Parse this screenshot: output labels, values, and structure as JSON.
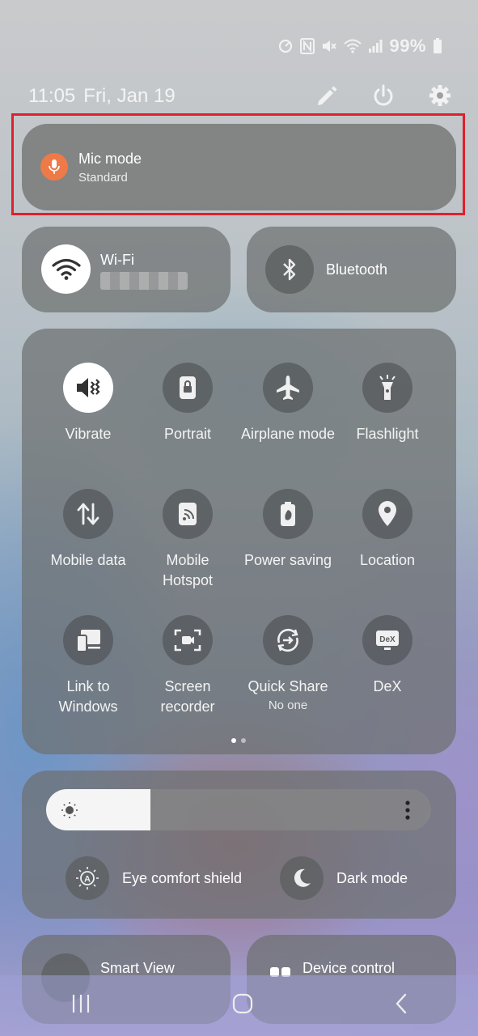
{
  "status": {
    "battery": "99%"
  },
  "header": {
    "time": "11:05",
    "date": "Fri, Jan 19"
  },
  "mic": {
    "title": "Mic mode",
    "subtitle": "Standard"
  },
  "wifi": {
    "label": "Wi-Fi"
  },
  "bluetooth": {
    "label": "Bluetooth"
  },
  "tiles": [
    {
      "label": "Vibrate"
    },
    {
      "label": "Portrait"
    },
    {
      "label": "Airplane mode"
    },
    {
      "label": "Flashlight"
    },
    {
      "label": "Mobile data"
    },
    {
      "label": "Mobile Hotspot"
    },
    {
      "label": "Power saving"
    },
    {
      "label": "Location"
    },
    {
      "label": "Link to Windows"
    },
    {
      "label": "Screen recorder"
    },
    {
      "label": "Quick Share",
      "sub": "No one"
    },
    {
      "label": "DeX"
    }
  ],
  "brightness": {
    "level": 0.27
  },
  "options": {
    "eye_comfort": "Eye comfort shield",
    "dark_mode": "Dark mode"
  },
  "bottom": {
    "smart_view": "Smart View",
    "device_control": "Device control"
  },
  "colors": {
    "mic_accent": "#ee7a48",
    "highlight": "#e0202a"
  }
}
